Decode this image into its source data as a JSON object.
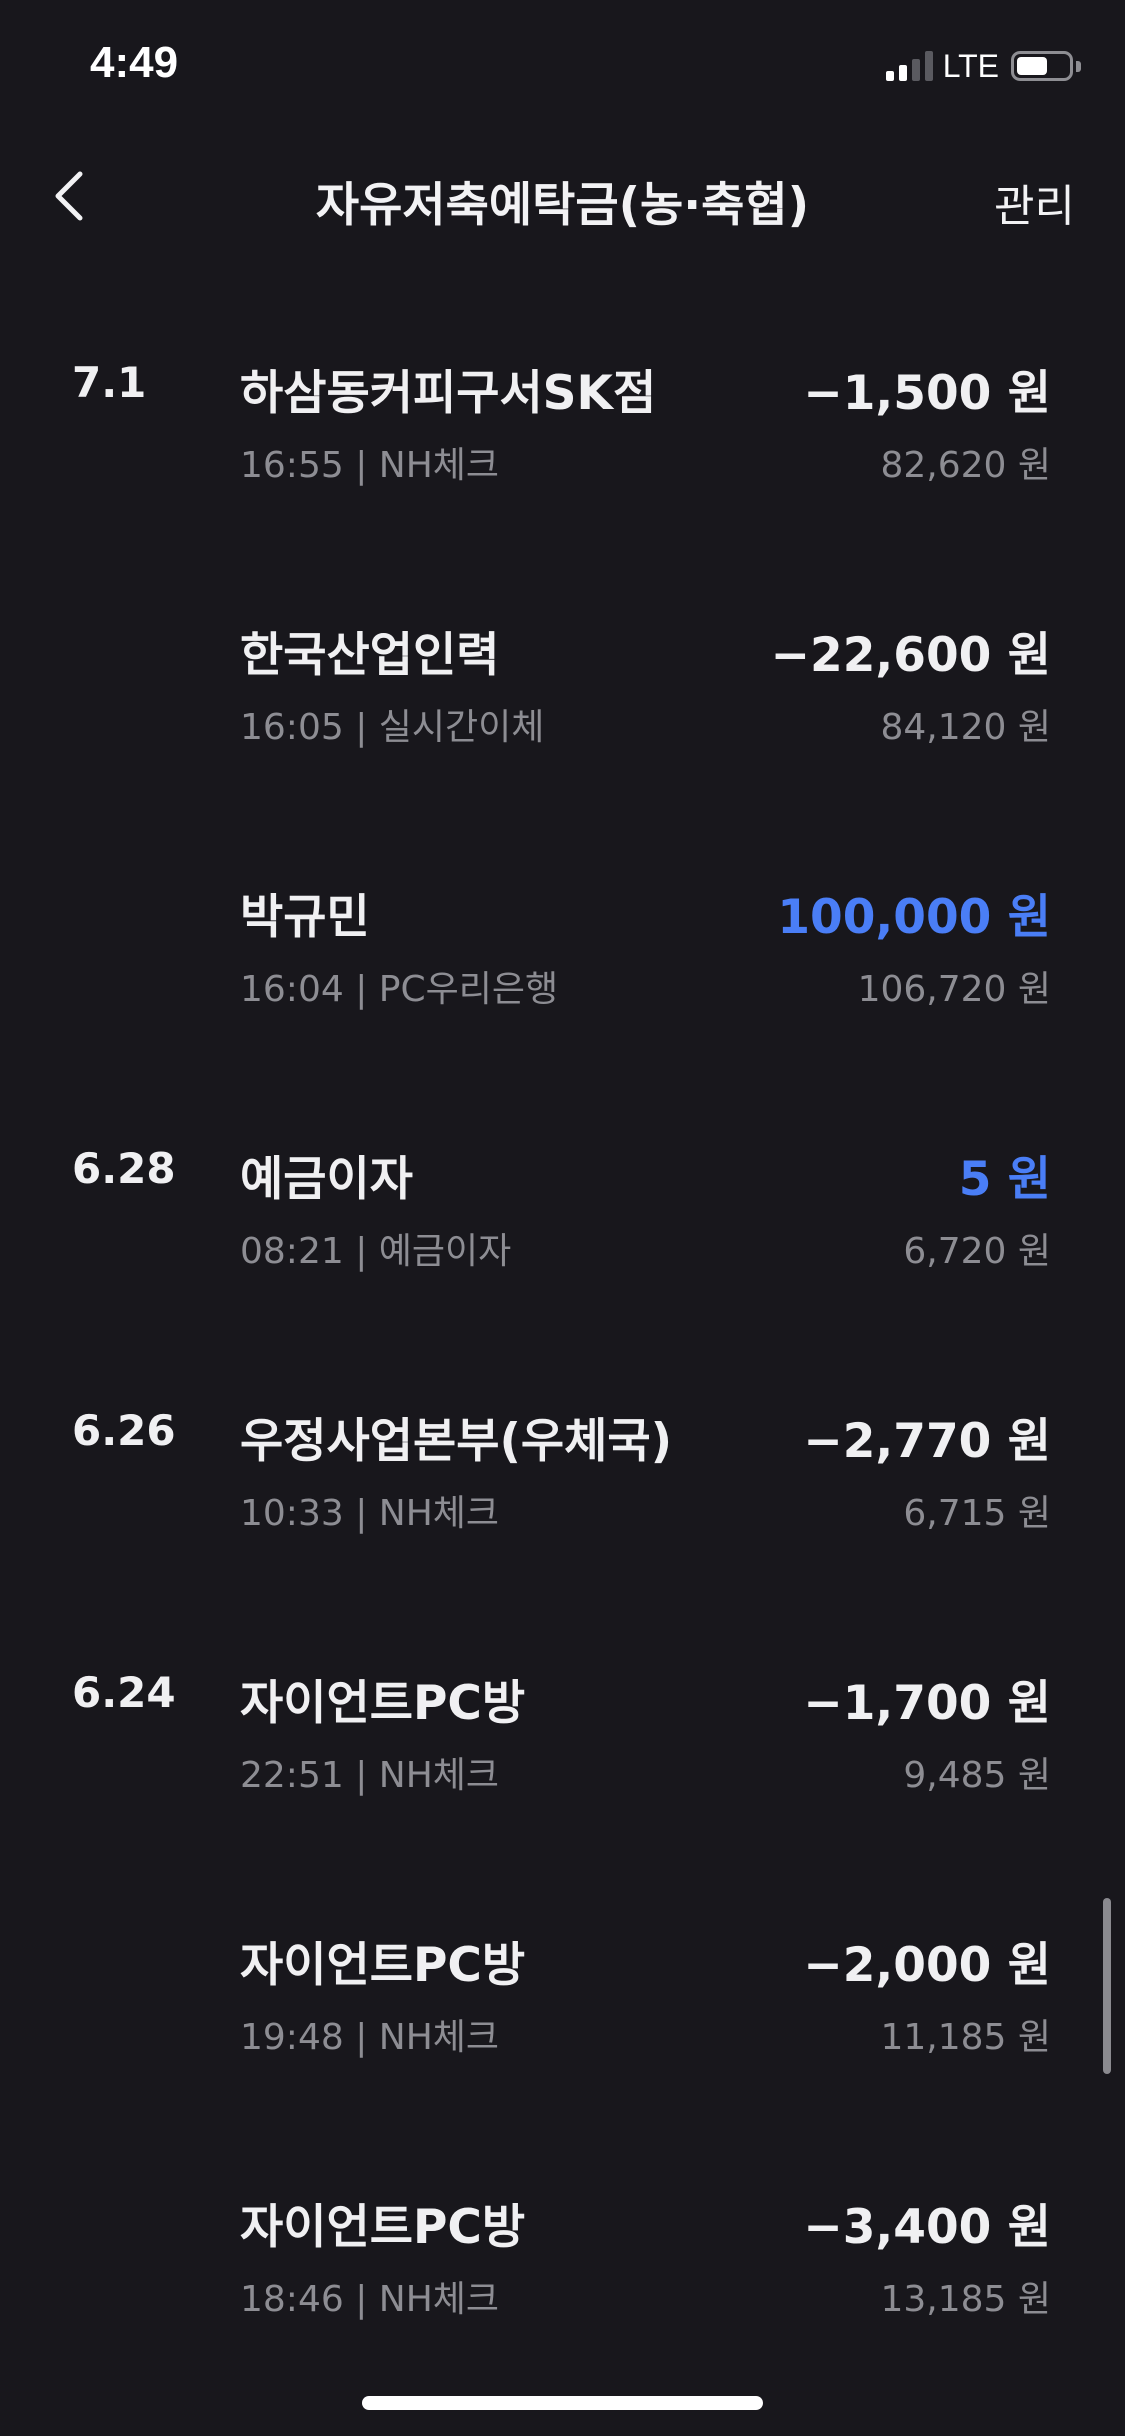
{
  "status_bar": {
    "time": "4:49",
    "network": "LTE"
  },
  "nav": {
    "back_icon": "chevron-left-icon",
    "title": "자유저축예탁금(농·축협)",
    "manage_label": "관리"
  },
  "transactions": [
    {
      "date": "7.1",
      "merchant": "하삼동커피구서SK점",
      "meta": "16:55 | NH체크",
      "amount": "−1,500 원",
      "balance": "82,620 원",
      "type": "withdrawal"
    },
    {
      "date": "",
      "merchant": "한국산업인력",
      "meta": "16:05 | 실시간이체",
      "amount": "−22,600 원",
      "balance": "84,120 원",
      "type": "withdrawal"
    },
    {
      "date": "",
      "merchant": "박규민",
      "meta": "16:04 | PC우리은행",
      "amount": "100,000 원",
      "balance": "106,720 원",
      "type": "deposit"
    },
    {
      "date": "6.28",
      "merchant": "예금이자",
      "meta": "08:21 | 예금이자",
      "amount": "5 원",
      "balance": "6,720 원",
      "type": "deposit"
    },
    {
      "date": "6.26",
      "merchant": "우정사업본부(우체국)",
      "meta": "10:33 | NH체크",
      "amount": "−2,770 원",
      "balance": "6,715 원",
      "type": "withdrawal"
    },
    {
      "date": "6.24",
      "merchant": "자이언트PC방",
      "meta": "22:51 | NH체크",
      "amount": "−1,700 원",
      "balance": "9,485 원",
      "type": "withdrawal"
    },
    {
      "date": "",
      "merchant": "자이언트PC방",
      "meta": "19:48 | NH체크",
      "amount": "−2,000 원",
      "balance": "11,185 원",
      "type": "withdrawal"
    },
    {
      "date": "",
      "merchant": "자이언트PC방",
      "meta": "18:46 | NH체크",
      "amount": "−3,400 원",
      "balance": "13,185 원",
      "type": "withdrawal"
    }
  ],
  "colors": {
    "background": "#18171c",
    "deposit": "#4a7ef6",
    "text_primary": "#f0f0f2",
    "text_secondary": "#8d8d93"
  }
}
